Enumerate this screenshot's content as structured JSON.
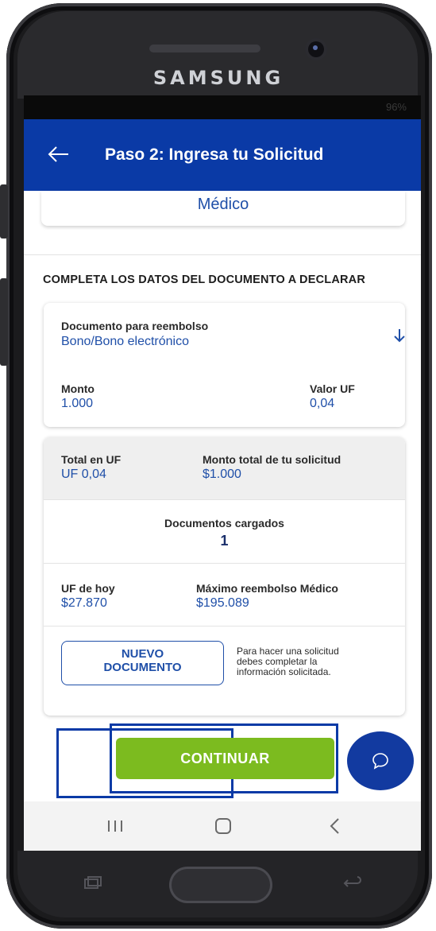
{
  "device": {
    "brand": "SAMSUNG",
    "battery": "96%"
  },
  "header": {
    "title": "Paso 2: Ingresa tu Solicitud"
  },
  "category_card": {
    "value": "Médico"
  },
  "section": {
    "title": "COMPLETA LOS DATOS DEL DOCUMENTO A DECLARAR"
  },
  "document": {
    "type_label": "Documento para reembolso",
    "type_value": "Bono/Bono electrónico",
    "amount_label": "Monto",
    "amount_value": "1.000",
    "uf_label": "Valor UF",
    "uf_value": "0,04"
  },
  "summary": {
    "total_uf_label": "Total en UF",
    "total_uf_value": "UF 0,04",
    "total_amount_label": "Monto total de tu solicitud",
    "total_amount_value": "$1.000",
    "docs_label": "Documentos cargados",
    "docs_value": "1",
    "uf_today_label": "UF de hoy",
    "uf_today_value": "$27.870",
    "max_label": "Máximo reembolso Médico",
    "max_value": "$195.089",
    "new_doc_line1": "NUEVO",
    "new_doc_line2": "DOCUMENTO",
    "hint_line1": "Para hacer una solicitud",
    "hint_line2": "debes completar la",
    "hint_line3": "información solicitada."
  },
  "actions": {
    "continue_label": "CONTINUAR"
  },
  "colors": {
    "primary": "#0a3aa6",
    "link_blue": "#1f4fa8",
    "continue_green": "#7cbb1f"
  }
}
